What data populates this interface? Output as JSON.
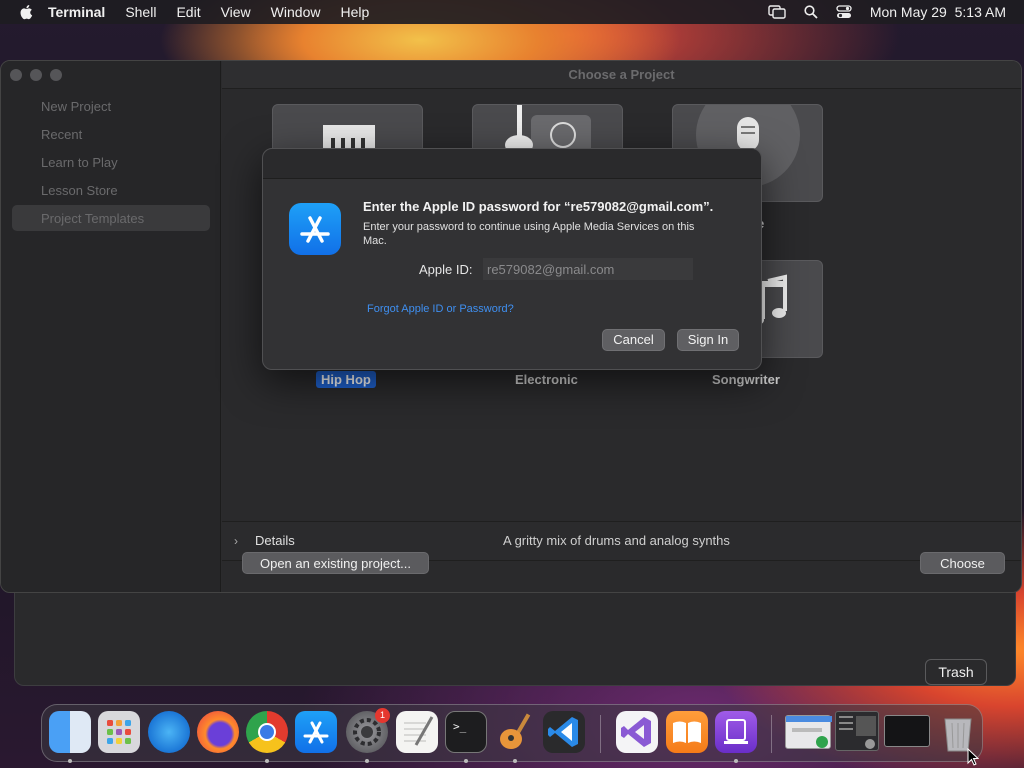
{
  "menubar": {
    "app_name": "Terminal",
    "items": [
      "Shell",
      "Edit",
      "View",
      "Window",
      "Help"
    ],
    "clock": "Mon May 29  5:13 AM"
  },
  "window": {
    "title": "Choose a Project",
    "sidebar": [
      "New Project",
      "Recent",
      "Learn to Play",
      "Lesson Store",
      "Project Templates"
    ],
    "selected_sidebar": "Project Templates",
    "tiles": [
      "Hip Hop",
      "Electronic",
      "Songwriter"
    ],
    "hidden_label_fragment": "e",
    "details_label": "Details",
    "details_description": "A gritty mix of drums and analog synths",
    "open_button": "Open an existing project...",
    "choose_button": "Choose"
  },
  "dialog": {
    "heading": "Enter the Apple ID password for “re579082@gmail.com”.",
    "subtext": "Enter your password to continue using Apple Media Services on this Mac.",
    "apple_id_label": "Apple ID:",
    "apple_id_value": "re579082@gmail.com",
    "forgot_link": "Forgot Apple ID or Password?",
    "cancel": "Cancel",
    "sign_in": "Sign In"
  },
  "dock": {
    "tooltip": "Trash",
    "badge": "1",
    "apps": [
      "Finder",
      "Launchpad",
      "Safari",
      "Firefox",
      "Chrome",
      "App Store",
      "System Preferences",
      "TextEdit",
      "Terminal",
      "GarageBand",
      "Visual Studio Code",
      "Visual Studio",
      "Books",
      "Podcast Studio",
      "Chrome window",
      "Finder window",
      "Terminal window",
      "Trash"
    ]
  }
}
